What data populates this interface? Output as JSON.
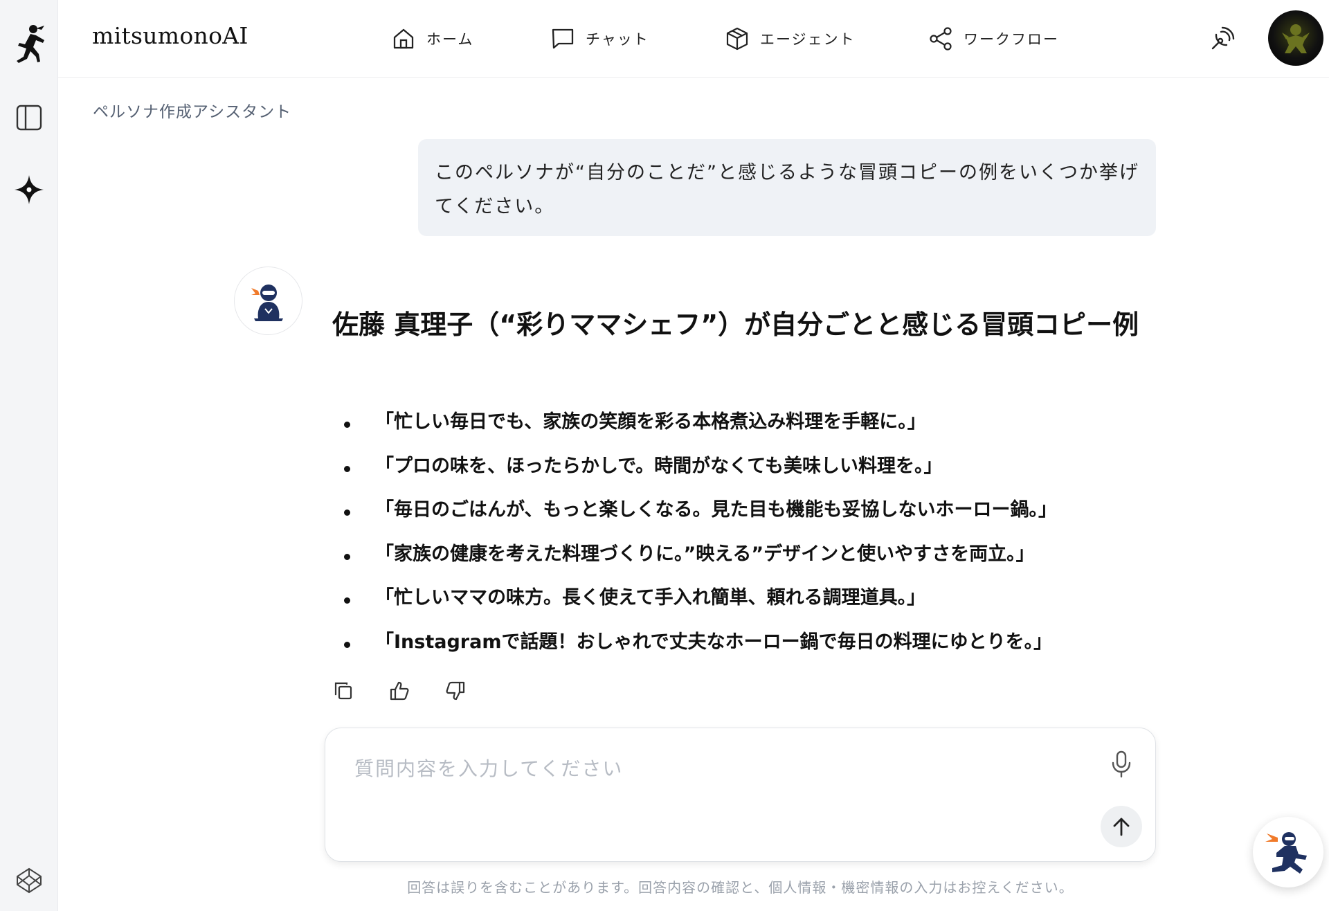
{
  "app": {
    "brand": "mitsumonoAI"
  },
  "nav": [
    {
      "label": "ホーム",
      "icon": "home-icon"
    },
    {
      "label": "チャット",
      "icon": "chat-icon"
    },
    {
      "label": "エージェント",
      "icon": "cube-icon"
    },
    {
      "label": "ワークフロー",
      "icon": "share-nodes-icon"
    }
  ],
  "breadcrumb": "ペルソナ作成アシスタント",
  "user_message": "このペルソナが“自分のことだ”と感じるような冒頭コピーの例をいくつか挙げてください。",
  "answer": {
    "title": "佐藤 真理子（“彩りママシェフ”）が自分ごとと感じる冒頭コピー例",
    "items": [
      "「忙しい毎日でも、家族の笑顔を彩る本格煮込み料理を手軽に。」",
      "「プロの味を、ほったらかしで。時間がなくても美味しい料理を。」",
      "「毎日のごはんが、もっと楽しくなる。見た目も機能も妥協しないホーロー鍋。」",
      "「家族の健康を考えた料理づくりに。”映える”デザインと使いやすさを両立。」",
      "「忙しいママの味方。長く使えて手入れ簡単、頼れる調理道具。」",
      "「Instagramで話題！おしゃれで丈夫なホーロー鍋で毎日の料理にゆとりを。」"
    ]
  },
  "composer": {
    "placeholder": "質問内容を入力してください",
    "value": ""
  },
  "disclaimer": "回答は誤りを含むことがあります。回答内容の確認と、個人情報・機密情報の入力はお控えください。",
  "colors": {
    "accent_orange": "#f07a2a",
    "ninja_navy": "#1f3160",
    "rail_bg": "#f4f5f7",
    "bubble_bg": "#eff2f6"
  }
}
